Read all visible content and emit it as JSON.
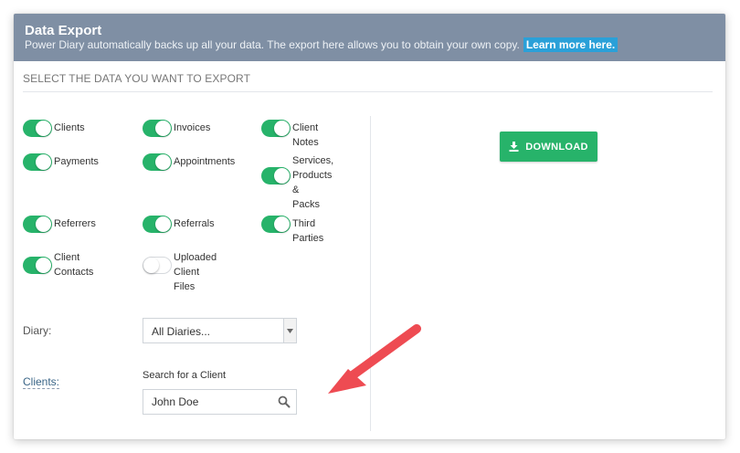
{
  "header": {
    "title": "Data Export",
    "subtitle": "Power Diary automatically backs up all your data. The export here allows you to obtain your own copy.",
    "learn_more": "Learn more here."
  },
  "section": {
    "title": "SELECT THE DATA YOU WANT TO EXPORT"
  },
  "toggles": [
    {
      "label": "Clients",
      "on": true
    },
    {
      "label": "Invoices",
      "on": true
    },
    {
      "label": "Client Notes",
      "on": true
    },
    {
      "label": "Payments",
      "on": true
    },
    {
      "label": "Appointments",
      "on": true
    },
    {
      "label_lines": [
        "Services,",
        "Products &",
        "Packs"
      ],
      "on": true
    },
    {
      "label": "Referrers",
      "on": true
    },
    {
      "label": "Referrals",
      "on": true
    },
    {
      "label": "Third Parties",
      "on": true
    },
    {
      "label_lines": [
        "Client",
        "Contacts"
      ],
      "on": true
    },
    {
      "label_lines": [
        "Uploaded",
        "Client Files"
      ],
      "on": false
    }
  ],
  "download": {
    "label": "DOWNLOAD",
    "icon": "download-icon"
  },
  "diary": {
    "label": "Diary:",
    "selected": "All Diaries..."
  },
  "clients": {
    "label": "Clients:",
    "search_caption": "Search for a Client",
    "search_value": "John Doe",
    "search_icon": "search-icon"
  },
  "colors": {
    "header_bg": "#7f8fa4",
    "accent_green": "#27b36a",
    "link_blue": "#2aa0d8",
    "arrow_red": "#ee4b52"
  }
}
